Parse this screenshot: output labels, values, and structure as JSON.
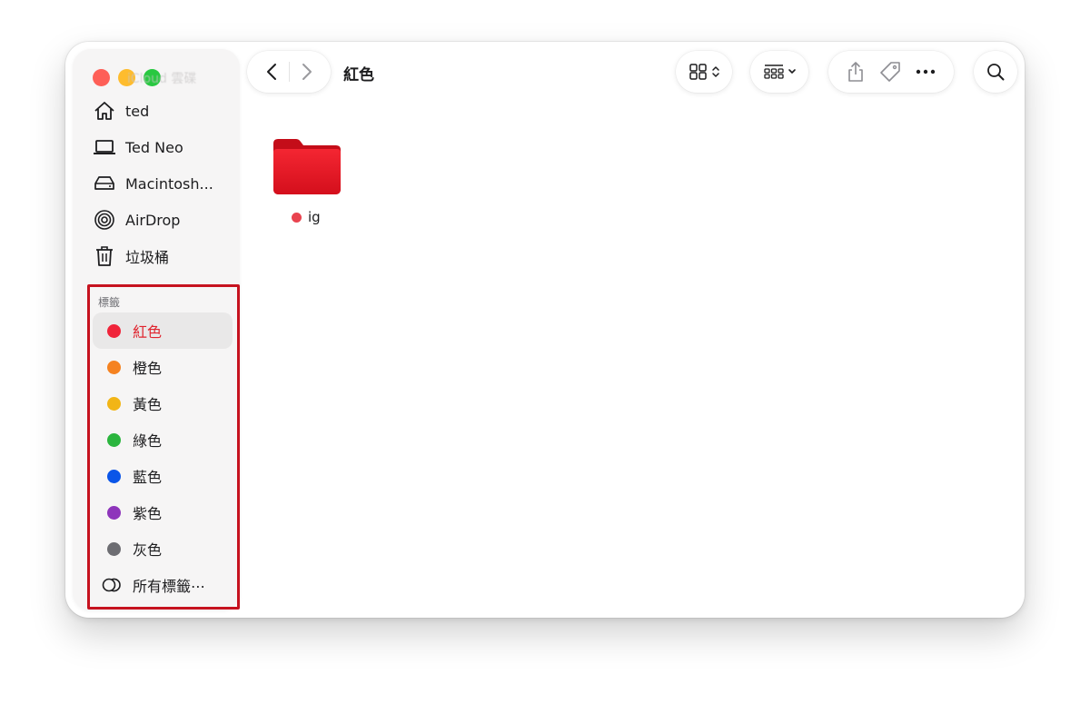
{
  "window": {
    "title": "紅色",
    "sidebar_faded_header": "iCloud 雲碟"
  },
  "sidebar": {
    "locations": [
      {
        "label": "ted",
        "icon": "home-icon"
      },
      {
        "label": "Ted Neo",
        "icon": "laptop-icon"
      },
      {
        "label": "Macintosh...",
        "icon": "disk-icon"
      },
      {
        "label": "AirDrop",
        "icon": "airdrop-icon"
      },
      {
        "label": "垃圾桶",
        "icon": "trash-icon"
      }
    ],
    "tags_header": "標籤",
    "tags": [
      {
        "label": "紅色",
        "color": "#f0243a",
        "active": true
      },
      {
        "label": "橙色",
        "color": "#f58220"
      },
      {
        "label": "黃色",
        "color": "#f2b516"
      },
      {
        "label": "綠色",
        "color": "#2bb53e"
      },
      {
        "label": "藍色",
        "color": "#0a55e8"
      },
      {
        "label": "紫色",
        "color": "#8e35bb"
      },
      {
        "label": "灰色",
        "color": "#6d6d72"
      }
    ],
    "all_tags": "所有標籤⋯"
  },
  "content": {
    "items": [
      {
        "name": "ig",
        "tag_color": "#e9434f",
        "icon": "folder-icon",
        "folder_color": "#e0141f"
      }
    ]
  },
  "colors": {
    "highlight_box": "#c6121f",
    "active_tag_text": "#e0242e"
  }
}
